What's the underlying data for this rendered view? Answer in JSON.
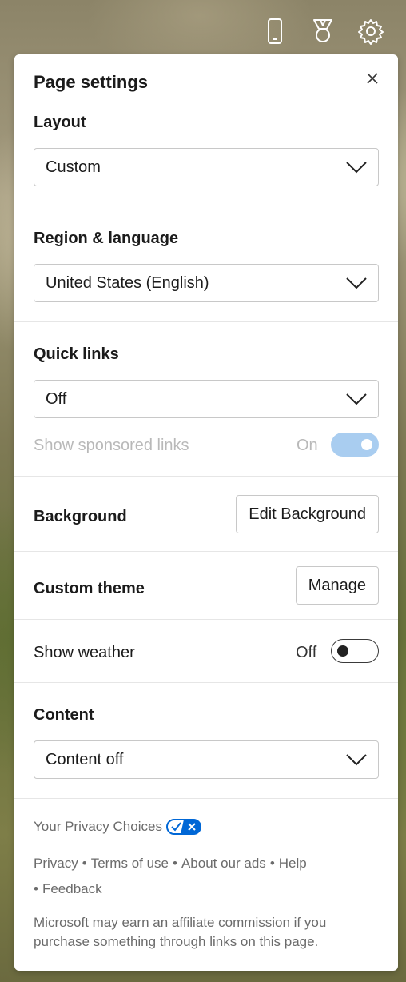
{
  "panel": {
    "title": "Page settings",
    "close_icon": "close-icon"
  },
  "topbar": {
    "icons": [
      "mobile-phone-icon",
      "trophy-icon",
      "gear-icon"
    ]
  },
  "layout": {
    "title": "Layout",
    "selected": "Custom"
  },
  "region": {
    "title": "Region & language",
    "selected": "United States (English)"
  },
  "quick_links": {
    "title": "Quick links",
    "selected": "Off",
    "sponsored_label": "Show sponsored links",
    "sponsored_state": "On"
  },
  "background": {
    "title": "Background",
    "button": "Edit Background"
  },
  "custom_theme": {
    "title": "Custom theme",
    "button": "Manage"
  },
  "weather": {
    "label": "Show weather",
    "state": "Off"
  },
  "content": {
    "title": "Content",
    "selected": "Content off"
  },
  "footer": {
    "privacy_choices": "Your Privacy Choices",
    "links": [
      "Privacy",
      "Terms of use",
      "About our ads",
      "Help",
      "Feedback"
    ],
    "separator": "•",
    "note": "Microsoft may earn an affiliate commission if you purchase something through links on this page."
  },
  "colors": {
    "toggle_on": "#a9cdf0",
    "privacy_badge": "#0067d6"
  }
}
